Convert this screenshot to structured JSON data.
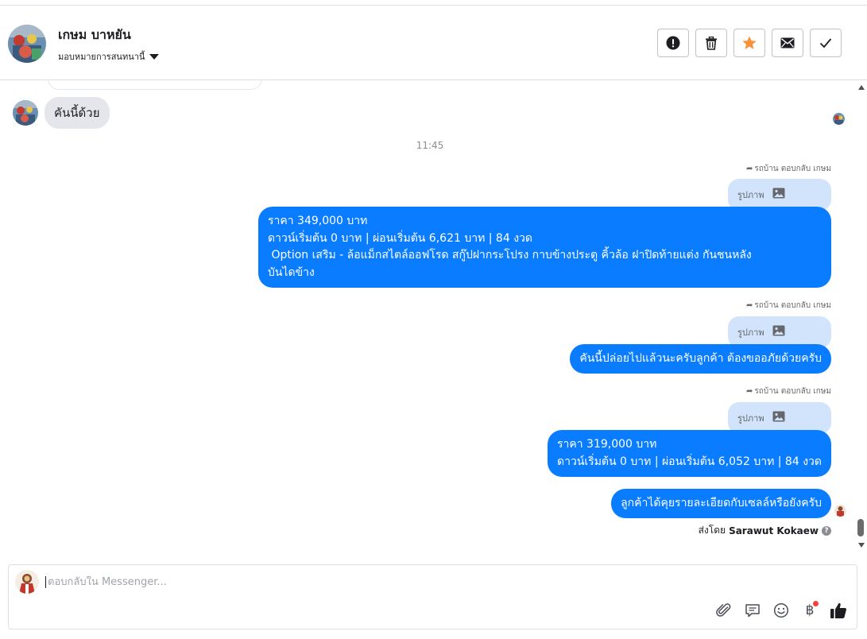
{
  "header": {
    "contact_name": "เกษม บาหยัน",
    "assign_label": "มอบหมายการสนทนานี้",
    "actions": [
      {
        "name": "spam-button",
        "icon": "exclamation-icon"
      },
      {
        "name": "delete-button",
        "icon": "trash-icon"
      },
      {
        "name": "star-button",
        "icon": "star-icon"
      },
      {
        "name": "mark-unread-button",
        "icon": "envelope-icon"
      },
      {
        "name": "done-button",
        "icon": "check-icon"
      }
    ]
  },
  "conversation": {
    "incoming_message": "คันนี้ด้วย",
    "timestamp": "11:45",
    "reply_label": "รถบ้าน ตอบกลับ เกษม",
    "quoted_label": "รูปภาพ",
    "messages": [
      {
        "lines": [
          "ราคา 349,000 บาท",
          "ดาวน์เริ่มต้น 0 บาท | ผ่อนเริ่มต้น 6,621 บาท | 84 งวด",
          " Option เสริม - ล้อแม็กสไตล์ออฟโรด สกู๊ปฝากระโปรง กาบข้างประตู คิ้วล้อ ฝาปิดท้ายแต่ง กันชนหลัง",
          "บันไดข้าง"
        ]
      },
      {
        "lines": [
          "คันนี้ปล่อยไปแล้วนะครับลูกค้า ต้องขออภัยด้วยครับ"
        ]
      },
      {
        "lines": [
          "ราคา 319,000 บาท",
          "ดาวน์เริ่มต้น 0 บาท | ผ่อนเริ่มต้น 6,052 บาท | 84 งวด"
        ]
      },
      {
        "lines": [
          "ลูกค้าได้คุยรายละเอียดกับเซลล์หรือยังครับ"
        ]
      }
    ],
    "sent_by_prefix": "ส่งโดย",
    "sent_by_name": "Sarawut Kokaew"
  },
  "composer": {
    "placeholder": "ตอบกลับใน Messenger...",
    "value": "",
    "baht_symbol": "฿",
    "tools": [
      "paperclip-icon",
      "saved-replies-icon",
      "emoji-icon",
      "baht-icon",
      "thumbs-up-icon"
    ]
  },
  "colors": {
    "outgoing_bubble": "#0a7cff",
    "quoted_bubble": "#d2e3fc",
    "incoming_bubble": "#e4e6eb",
    "star": "#f7923b"
  }
}
